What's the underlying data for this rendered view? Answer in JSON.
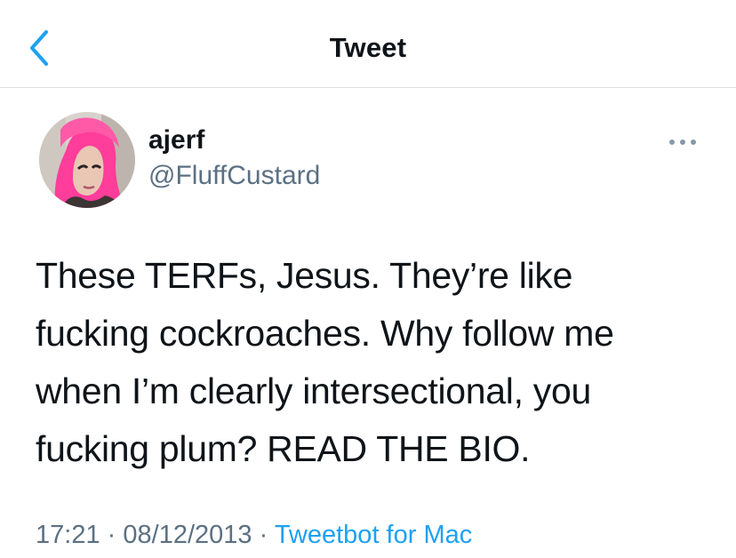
{
  "header": {
    "title": "Tweet"
  },
  "tweet": {
    "author": {
      "display_name": "ajerf",
      "handle": "@FluffCustard"
    },
    "text_lines": [
      "These TERFs, Jesus. They’re like",
      "fucking cockroaches. Why follow me",
      "when I’m clearly intersectional, you",
      "fucking plum? READ THE BIO."
    ],
    "time": "17:21",
    "separator": "·",
    "date": "08/12/2013",
    "source": "Tweetbot for Mac"
  },
  "icons": {
    "back": "chevron-left-icon",
    "more": "more-horizontal-icon",
    "avatar": "profile-photo"
  },
  "colors": {
    "accent": "#1da1f2",
    "secondary_text": "#5b7083",
    "primary_text": "#0f1419",
    "avatar_hair": "#ff3d9a",
    "divider": "#dcdfe2"
  }
}
